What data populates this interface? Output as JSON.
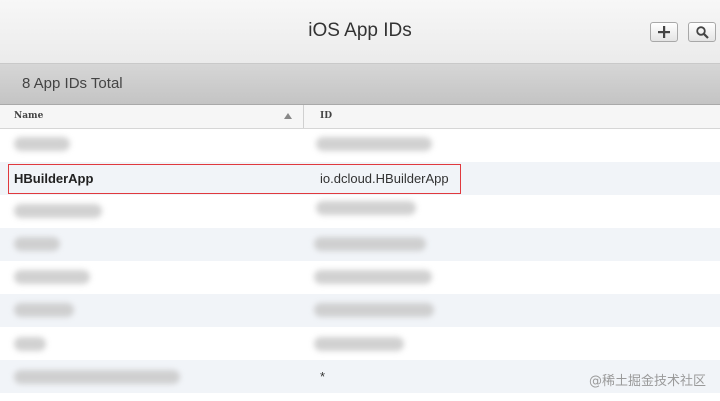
{
  "header": {
    "title": "iOS App IDs"
  },
  "summary": {
    "total_label": "8 App IDs Total"
  },
  "table": {
    "columns": [
      "Name",
      "ID"
    ],
    "rows": [
      {
        "name": "",
        "id": "",
        "obscured": true
      },
      {
        "name": "HBuilderApp",
        "id": "io.dcloud.HBuilderApp",
        "obscured": false,
        "highlighted": true
      },
      {
        "name": "",
        "id": "",
        "obscured": true
      },
      {
        "name": "",
        "id": "",
        "obscured": true
      },
      {
        "name": "",
        "id": "",
        "obscured": true
      },
      {
        "name": "",
        "id": "",
        "obscured": true
      },
      {
        "name": "",
        "id": "",
        "obscured": true
      },
      {
        "name": "",
        "id": "*",
        "obscured": true
      }
    ]
  },
  "watermark": "@稀土掘金技术社区",
  "icons": {
    "add": "plus-icon",
    "search": "magnifier-icon",
    "sort": "sort-ascending-icon"
  },
  "colors": {
    "highlight_border": "#e0393e"
  }
}
